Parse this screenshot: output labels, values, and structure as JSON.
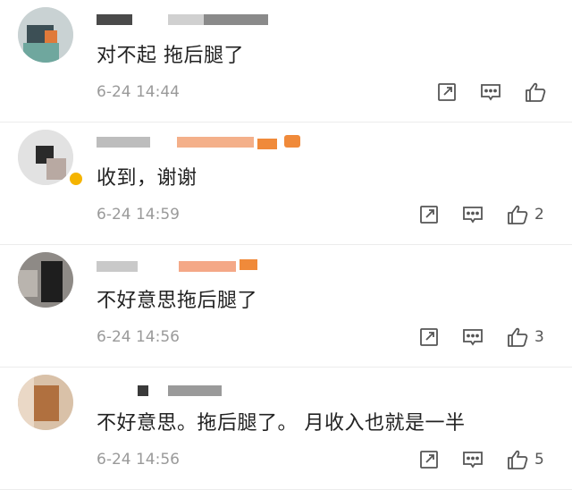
{
  "comments": [
    {
      "text": "对不起 拖后腿了",
      "time": "6-24 14:44",
      "like_count": ""
    },
    {
      "text": "收到，谢谢",
      "time": "6-24 14:59",
      "like_count": "2"
    },
    {
      "text": "不好意思拖后腿了",
      "time": "6-24 14:56",
      "like_count": "3"
    },
    {
      "text": "不好意思。拖后腿了。 月收入也就是一半",
      "time": "6-24 14:56",
      "like_count": "5"
    }
  ],
  "icons": {
    "repost": "repost-icon",
    "comment": "comment-icon",
    "like": "thumbs-up-icon"
  },
  "colors": {
    "text": "#222222",
    "meta": "#9a9a9a",
    "icon": "#555555",
    "accent": "#f08a3a"
  }
}
